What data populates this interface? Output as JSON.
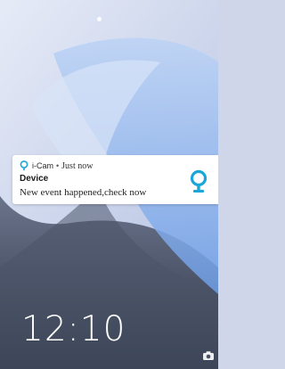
{
  "lock_screen": {
    "clock": "12:10"
  },
  "notification": {
    "app_name": "i-Cam",
    "separator": "•",
    "time": "Just now",
    "title": "Device",
    "body": "New event happened,check now",
    "app_icon": "location-pin-icon",
    "large_icon": "location-pin-icon",
    "accent_color": "#1aa6d9"
  },
  "shortcuts": {
    "camera_icon": "camera-icon"
  }
}
